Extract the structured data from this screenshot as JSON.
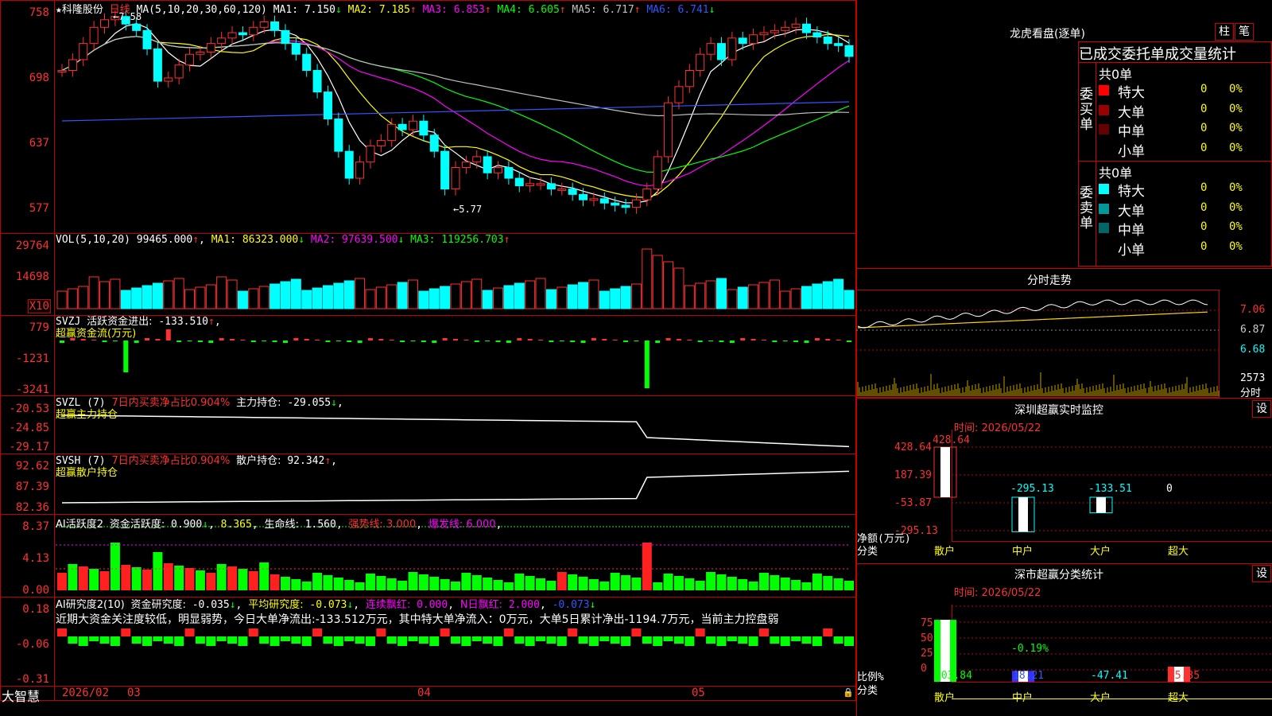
{
  "stock": {
    "name": "科隆股份",
    "period": "日线",
    "star": "★",
    "ma_label": "MA(5,10,20,30,60,120)"
  },
  "ma_readout": [
    {
      "label": "MA1:",
      "value": "7.150",
      "arrow": "↓",
      "color": "#ffffff"
    },
    {
      "label": "MA2:",
      "value": "7.185",
      "arrow": "↑",
      "color": "#ffff00"
    },
    {
      "label": "MA3:",
      "value": "6.853",
      "arrow": "↑",
      "color": "#ff00ff"
    },
    {
      "label": "MA4:",
      "value": "6.605",
      "arrow": "↑",
      "color": "#00ff00"
    },
    {
      "label": "MA5:",
      "value": "6.717",
      "arrow": "↑",
      "color": "#c0c0c0"
    },
    {
      "label": "MA6:",
      "value": "6.741",
      "arrow": "↓",
      "color": "#3355ff"
    }
  ],
  "price_axis": [
    "758",
    "698",
    "637",
    "577"
  ],
  "price_marks": {
    "high": "7.58",
    "low": "5.77"
  },
  "vol_panel": {
    "label": "VOL(5,10,20)",
    "value": "99465.000",
    "arrow": "↑",
    "ma": [
      {
        "label": "MA1:",
        "value": "86323.000",
        "arrow": "↓",
        "color": "#ffff00"
      },
      {
        "label": "MA2:",
        "value": "97639.500",
        "arrow": "↓",
        "color": "#ff00ff"
      },
      {
        "label": "MA3:",
        "value": "119256.703",
        "arrow": "↑",
        "color": "#00ff00"
      }
    ],
    "axis": [
      "29764",
      "14698"
    ],
    "unit": "X10"
  },
  "svzj_panel": {
    "label": "SVZJ",
    "title": "活跃资金进出:",
    "value": "-133.510",
    "arrow": "↑",
    "sub": "超赢资金流(万元)",
    "axis": [
      "779",
      "-1231",
      "-3241"
    ]
  },
  "svzl_panel": {
    "label": "SVZL (7)",
    "ratio": "7日内买卖净占比0.904%",
    "title": "主力持仓:",
    "value": "-29.055",
    "arrow": "↓",
    "sub": "超赢主力持仓",
    "axis": [
      "-20.53",
      "-24.85",
      "-29.17"
    ]
  },
  "svsh_panel": {
    "label": "SVSH (7)",
    "ratio": "7日内买卖净占比0.904%",
    "title": "散户持仓:",
    "value": "92.342",
    "arrow": "↑",
    "sub": "超赢散户持仓",
    "axis": [
      "92.62",
      "87.39",
      "82.36"
    ]
  },
  "ai_active": {
    "label": "AI活跃度2",
    "title": "资金活跃度:",
    "value": "0.900",
    "arrow": "↓",
    "v2": "8.365",
    "life_label": "生命线:",
    "life": "1.560",
    "strong": "强势线: 3.000",
    "burst": "爆发线: 6.000",
    "axis": [
      "8.37",
      "4.13",
      "0.00"
    ]
  },
  "ai_research": {
    "label": "AI研究度2(10)",
    "title": "资金研究度:",
    "value": "-0.035",
    "arrow": "↓",
    "avg_label": "平均研究度:",
    "avg": "-0.073",
    "red_label": "连续飘红:",
    "red": "0.000",
    "n_label": "N日飘红:",
    "n": "2.000",
    "last": "-0.073",
    "text": "近期大资金关注度较低，明显弱势，今日大单净流出:-133.512万元，其中特大单净流入：0万元，大单5日累计净出-1194.7万元，当前主力控盘弱",
    "axis": [
      "0.18",
      "-0.06",
      "-0.31"
    ]
  },
  "bottom_bar": {
    "brand": "大智慧",
    "dates": [
      "2026/02",
      "03",
      "04",
      "05"
    ]
  },
  "dragon": {
    "title": "龙虎看盘(逐单)",
    "btn1": "柱",
    "btn2": "笔",
    "tabs": "已成交委托单成交量统计",
    "buy": {
      "side": "委买单",
      "total": "共0单",
      "rows": [
        {
          "label": "特大",
          "count": "0",
          "pct": "0%",
          "color": "#ff0000"
        },
        {
          "label": "大单",
          "count": "0",
          "pct": "0%",
          "color": "#990000"
        },
        {
          "label": "中单",
          "count": "0",
          "pct": "0%",
          "color": "#660000"
        },
        {
          "label": "小单",
          "count": "0",
          "pct": "0%",
          "color": ""
        }
      ]
    },
    "sell": {
      "side": "委卖单",
      "total": "共0单",
      "rows": [
        {
          "label": "特大",
          "count": "0",
          "pct": "0%",
          "color": "#00ffff"
        },
        {
          "label": "大单",
          "count": "0",
          "pct": "0%",
          "color": "#009999"
        },
        {
          "label": "中单",
          "count": "0",
          "pct": "0%",
          "color": "#006666"
        },
        {
          "label": "小单",
          "count": "0",
          "pct": "0%",
          "color": ""
        }
      ]
    }
  },
  "intraday": {
    "title": "分时走势",
    "axis": [
      "7.06",
      "6.87",
      "6.68"
    ],
    "vol_axis": "2573",
    "vol_label": "分时"
  },
  "sz_monitor": {
    "title": "深圳超赢实时监控",
    "btn": "设",
    "time": "时间: 2026/05/22",
    "axis": [
      "428.64",
      "187.39",
      "-53.87",
      "-295.13"
    ],
    "ylabel": "净额(万元)",
    "xlabel": "分类",
    "cats": [
      "散户",
      "中户",
      "大户",
      "超大"
    ],
    "values": [
      "428.64",
      "-295.13",
      "-133.51",
      "0"
    ]
  },
  "sz_class": {
    "title": "深市超赢分类统计",
    "btn": "设",
    "time": "时间: 2026/05/22",
    "axis": [
      "75",
      "50",
      "25",
      "0"
    ],
    "ylabel": "比例%",
    "xlabel": "分类",
    "cats": [
      "散户",
      "中户",
      "大户",
      "超大"
    ],
    "values": [
      "103.84",
      "18.21",
      "-47.41",
      "25.35"
    ],
    "note": "-0.19%"
  },
  "chart_data": [
    {
      "type": "bar",
      "title": "深圳超赢实时监控",
      "categories": [
        "散户",
        "中户",
        "大户",
        "超大"
      ],
      "values": [
        428.64,
        -295.13,
        -133.51,
        0
      ],
      "ylabel": "净额(万元)",
      "xlabel": "分类",
      "ylim": [
        -295.13,
        428.64
      ]
    },
    {
      "type": "bar",
      "title": "深市超赢分类统计",
      "categories": [
        "散户",
        "中户",
        "大户",
        "超大"
      ],
      "values": [
        103.84,
        18.21,
        -47.41,
        25.35
      ],
      "ylabel": "比例%",
      "xlabel": "分类",
      "ylim": [
        0,
        100
      ]
    }
  ]
}
